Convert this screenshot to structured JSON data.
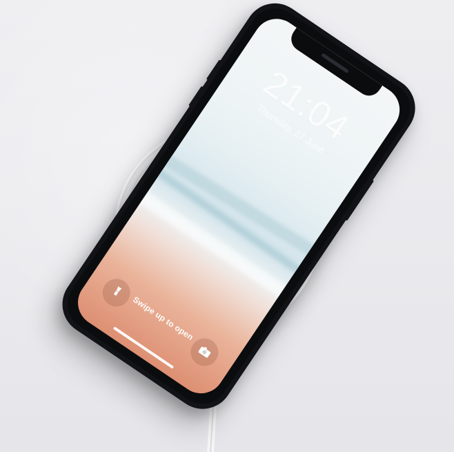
{
  "phone": {
    "time": "21:04",
    "date": "Thursday, 27 June",
    "swipe_text": "Swipe up to open",
    "left_action_icon": "flashlight-icon",
    "right_action_icon": "camera-icon"
  },
  "scene": {
    "charger": "wireless charging pad",
    "background_color": "#e9e9ed",
    "accent_color": "#dd8f72"
  }
}
